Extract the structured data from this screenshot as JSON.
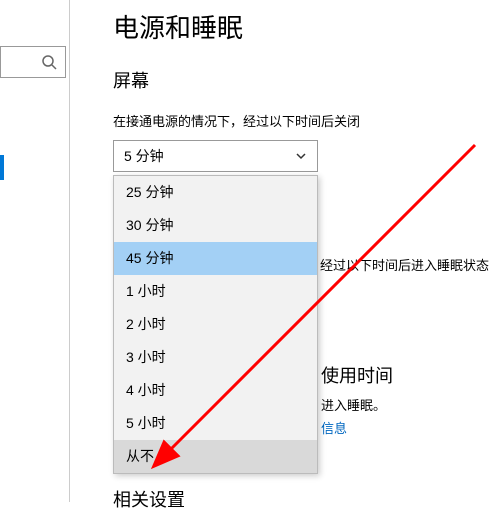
{
  "page_title": "电源和睡眠",
  "section_screen": "屏幕",
  "screen_off_label": "在接通电源的情况下，经过以下时间后关闭",
  "combo1_value": "5 分钟",
  "dropdown_items": [
    {
      "label": "25 分钟",
      "state": ""
    },
    {
      "label": "30 分钟",
      "state": ""
    },
    {
      "label": "45 分钟",
      "state": "selected"
    },
    {
      "label": "1 小时",
      "state": ""
    },
    {
      "label": "2 小时",
      "state": ""
    },
    {
      "label": "3 小时",
      "state": ""
    },
    {
      "label": "4 小时",
      "state": ""
    },
    {
      "label": "5 小时",
      "state": ""
    },
    {
      "label": "从不",
      "state": "hover"
    }
  ],
  "sleep_label_fragment": "经过以下时间后进入睡眠状态",
  "save_heading_fragment": "使用时间",
  "save_text_fragment": "进入睡眠。",
  "link_fragment": "信息",
  "related_settings": "相关设置"
}
